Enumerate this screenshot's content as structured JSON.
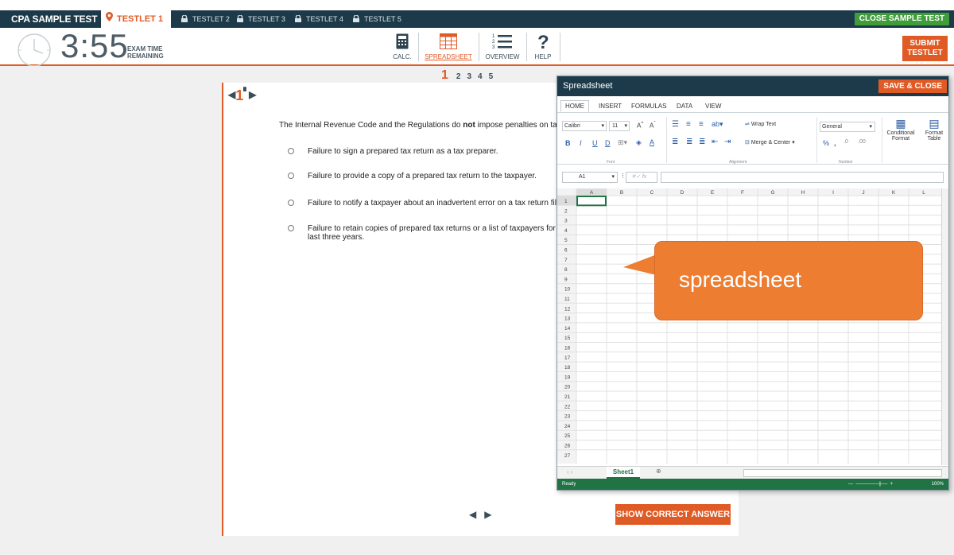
{
  "topbar": {
    "brand": "CPA SAMPLE TEST",
    "active_tab": "TESTLET 1",
    "locked_tabs": [
      "TESTLET 2",
      "TESTLET 3",
      "TESTLET 4",
      "TESTLET 5"
    ],
    "close_label": "CLOSE SAMPLE TEST"
  },
  "toolbar": {
    "time": "3:55",
    "time_label_1": "EXAM TIME",
    "time_label_2": "REMAINING",
    "tools": {
      "calc": "CALC.",
      "spreadsheet": "SPREADSHEET",
      "overview": "OVERVIEW",
      "help": "HELP"
    },
    "submit_1": "SUBMIT",
    "submit_2": "TESTLET"
  },
  "pager": {
    "current": "1",
    "pages": [
      "2",
      "3",
      "4",
      "5"
    ]
  },
  "question": {
    "number": "1",
    "stem_pre": "The Internal Revenue Code and the Regulations do ",
    "stem_bold": "not",
    "stem_post": " impose penalties on tax re",
    "options": [
      "Failure to sign a prepared tax return as a tax preparer.",
      "Failure to provide a copy of a prepared tax return to the taxpayer.",
      "Failure to notify a taxpayer about an inadvertent error on a tax return filed",
      "Failure to retain copies of prepared tax returns or a list of taxpayers for wh"
    ],
    "option4_line2": "last three years.",
    "show_answer": "SHOW CORRECT ANSWER"
  },
  "spreadsheet": {
    "title": "Spreadsheet",
    "save_close": "SAVE & CLOSE",
    "ribbon_tabs": [
      "HOME",
      "INSERT",
      "FORMULAS",
      "DATA",
      "VIEW"
    ],
    "font_name": "Calibri",
    "font_size": "11",
    "wrap_text": "Wrap Text",
    "merge_center": "Merge & Center",
    "number_format": "General",
    "conditional_1": "Conditional",
    "conditional_2": "Format",
    "format_table_1": "Format",
    "format_table_2": "Table",
    "group_font": "Font",
    "group_alignment": "Alignment",
    "group_number": "Number",
    "name_box": "A1",
    "fx": "fx",
    "columns": [
      "A",
      "B",
      "C",
      "D",
      "E",
      "F",
      "G",
      "H",
      "I",
      "J",
      "K",
      "L"
    ],
    "row_count": 27,
    "sheet_tab": "Sheet1",
    "status": "Ready",
    "zoom": "100%"
  },
  "callout": {
    "text": "spreadsheet"
  },
  "colors": {
    "accent": "#e05a25",
    "navy": "#1c3a49",
    "excel_green": "#217346",
    "callout": "#ed7d31"
  }
}
